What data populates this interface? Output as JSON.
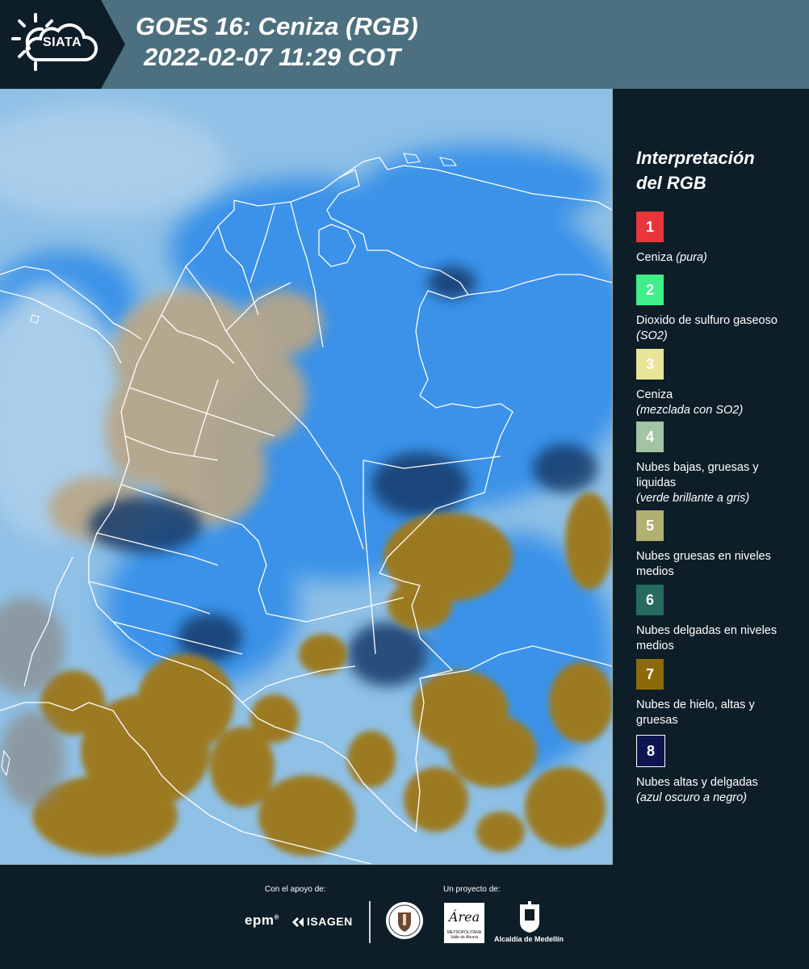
{
  "header": {
    "brand": "SIATA",
    "title_line1": "GOES 16: Ceniza (RGB)",
    "title_line2": "2022-02-07 11:29 COT"
  },
  "legend": {
    "title_line1": "Interpretación",
    "title_line2": "del RGB",
    "items": [
      {
        "number": "1",
        "color": "#e8363a",
        "text": "Ceniza ",
        "note": "(pura)"
      },
      {
        "number": "2",
        "color": "#3ff08a",
        "text": "Dioxido de sulfuro gaseoso ",
        "note": "(SO2)"
      },
      {
        "number": "3",
        "color": "#e9e596",
        "text": "Ceniza",
        "note": "(mezclada con SO2)"
      },
      {
        "number": "4",
        "color": "#a3c3a5",
        "text": "Nubes bajas, gruesas y liquidas",
        "note": "(verde brillante a gris)"
      },
      {
        "number": "5",
        "color": "#b1b070",
        "text": "Nubes gruesas en niveles medios",
        "note": ""
      },
      {
        "number": "6",
        "color": "#266b5d",
        "text": "Nubes delgadas en niveles medios",
        "note": ""
      },
      {
        "number": "7",
        "color": "#8c6a0a",
        "text": "Nubes de hielo, altas y gruesas",
        "note": ""
      },
      {
        "number": "8",
        "color": "#0d1650",
        "text": "Nubes altas y delgadas",
        "note": "(azul oscuro a negro)"
      }
    ]
  },
  "map": {
    "ocean_color": "#8fc0e6",
    "cloud_blue_color": "#3a92e8",
    "ice_cloud_color": "#9c7a22",
    "border_color": "#ffffff"
  },
  "footer": {
    "support_label": "Con el apoyo de:",
    "project_label": "Un proyecto de:",
    "sponsor1": "epm",
    "sponsor2": "ISAGEN",
    "partner1": "Área",
    "partner1_sub": "METROPOLITANA Valle de Aburrá",
    "partner2": "Alcaldía de Medellín"
  }
}
